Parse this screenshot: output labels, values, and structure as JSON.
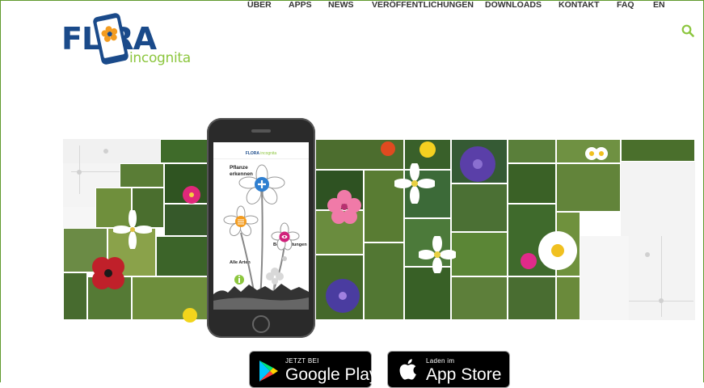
{
  "brand": {
    "logo_main": "FL RA",
    "logo_sub": "incognita",
    "colors": {
      "blue": "#1a4a8a",
      "green": "#8cc63e",
      "frame": "#5f9a2e"
    }
  },
  "nav": {
    "items": [
      "ÜBER",
      "APPS",
      "NEWS",
      "VERÖFFENTLICHUNGEN",
      "DOWNLOADS",
      "KONTAKT",
      "FAQ",
      "EN"
    ],
    "search_icon": "search-icon"
  },
  "phone_screen": {
    "app_title": "FLORA",
    "app_title_sub": "incognita",
    "labels": {
      "identify": "Pflanze erkennen",
      "observations": "Meine Beobachtungen",
      "all_species": "Alle Arten"
    }
  },
  "badges": {
    "google": {
      "small": "JETZT BEI",
      "big": "Google Play",
      "icon": "google-play-icon"
    },
    "apple": {
      "small": "Laden im",
      "big": "App Store",
      "icon": "apple-icon"
    }
  }
}
